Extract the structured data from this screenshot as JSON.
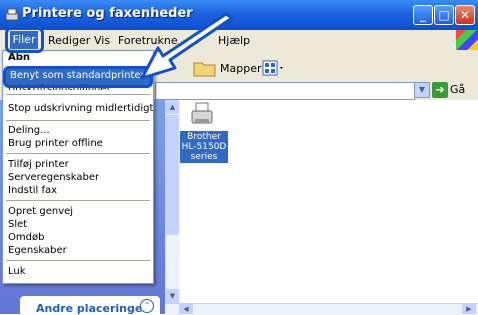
{
  "window": {
    "title": "Printere og faxenheder"
  },
  "menubar": {
    "items": [
      "Filer",
      "Rediger",
      "Vis",
      "Foretrukne",
      "Hjælp"
    ]
  },
  "toolbar": {
    "folders_label": "Mapper"
  },
  "address": {
    "go_label": "Gå"
  },
  "file_menu": {
    "items": [
      "Åbn",
      "Benyt som standardprinter",
      "Udskriftsindstillinger...",
      "Stop udskrivning midlertidigt",
      "Deling...",
      "Brug printer offline",
      "Tilføj printer",
      "Serveregenskaber",
      "Indstil fax",
      "Opret genvej",
      "Slet",
      "Omdøb",
      "Egenskaber",
      "Luk"
    ]
  },
  "printers": [
    {
      "name": "Brother HL-5150D series",
      "lines": [
        "Brother",
        "HL-5150D",
        "series"
      ]
    }
  ],
  "task_pane": {
    "other_places_label": "Andre placeringer"
  },
  "colors": {
    "highlight": "#316ac5",
    "callout_blue": "#1250c8",
    "titlebar": "#0c4fd1"
  }
}
